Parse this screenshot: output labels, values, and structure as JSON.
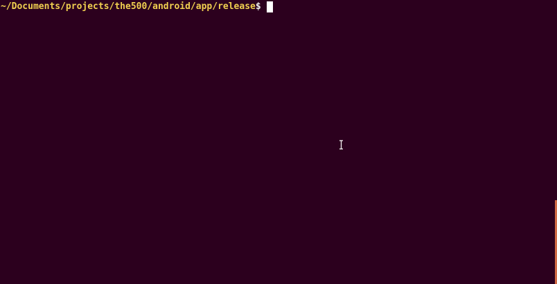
{
  "terminal": {
    "prompt_path": "~/Documents/projects/the500/android/app/release",
    "prompt_symbol": "$",
    "colors": {
      "background": "#2c001e",
      "path": "#f0d050",
      "symbol": "#eeeeec",
      "cursor": "#ffffff",
      "scrollbar": "#cf6a45"
    },
    "icons": {
      "mouse_pointer": "text-ibeam-cursor-icon"
    }
  }
}
